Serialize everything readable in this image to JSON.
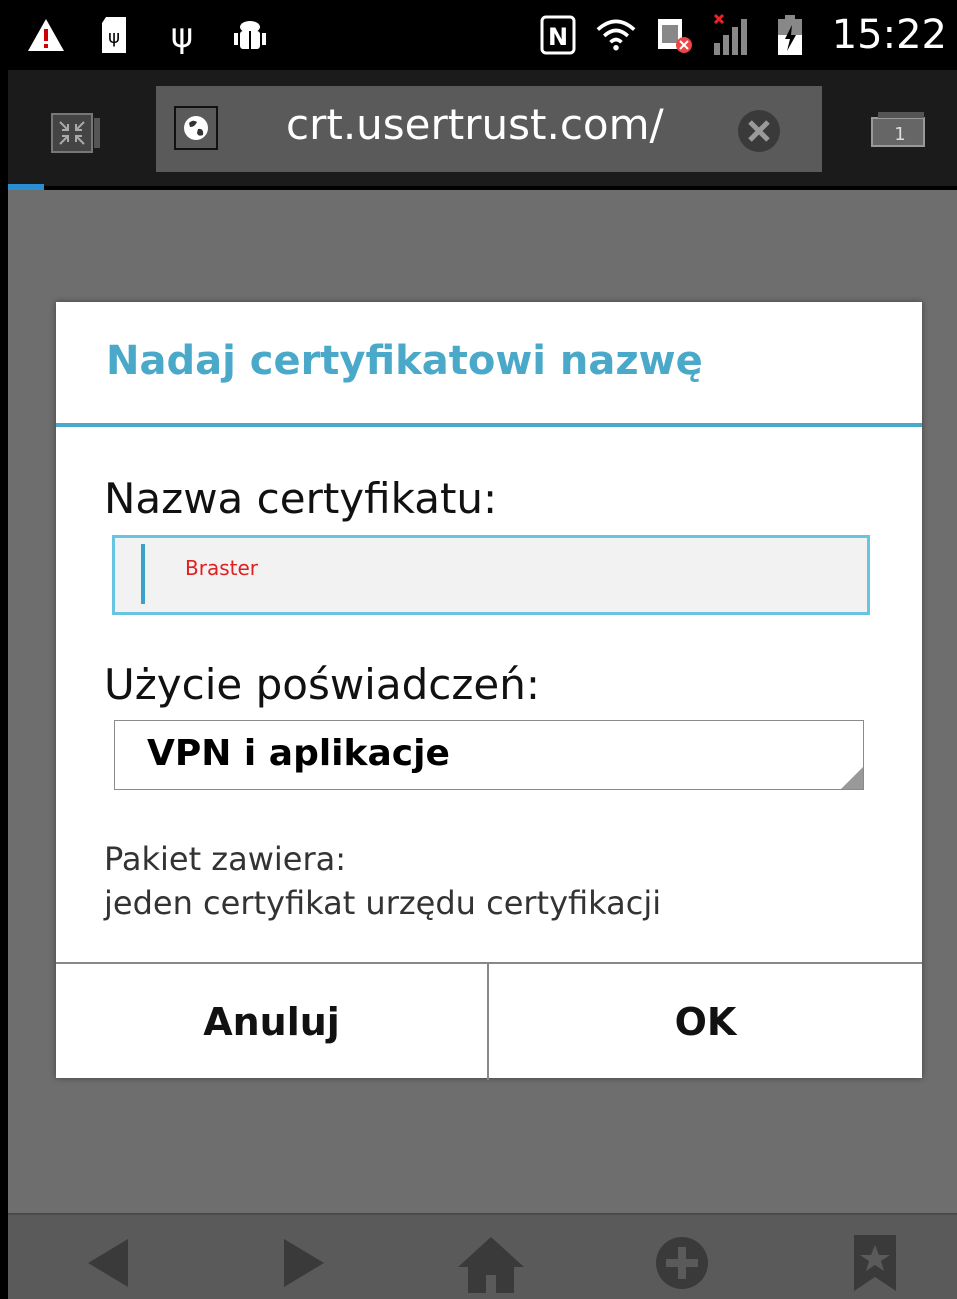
{
  "status_bar": {
    "time": "15:22",
    "left_icons": [
      "warning-icon",
      "sd-card-icon",
      "usb-icon",
      "android-debug-icon"
    ],
    "right_icons": [
      "nfc-icon",
      "wifi-icon",
      "sim-error-icon",
      "signal-no-service-icon",
      "battery-charging-icon"
    ]
  },
  "browser": {
    "url": "crt.usertrust.com/"
  },
  "dialog": {
    "title": "Nadaj certyfikatowi nazwę",
    "name_label": "Nazwa certyfikatu:",
    "name_value": "Braster",
    "usage_label": "Użycie poświadczeń:",
    "usage_value": "VPN i aplikacje",
    "package_label": "Pakiet zawiera:",
    "package_content": "jeden certyfikat urzędu certyfikacji",
    "cancel_label": "Anuluj",
    "ok_label": "OK"
  },
  "bottom_nav": [
    "back-icon",
    "forward-icon",
    "home-icon",
    "add-icon",
    "bookmarks-icon"
  ],
  "colors": {
    "accent": "#4aa8c8",
    "input_text": "#e02020",
    "overlay": "#6e6e6e"
  }
}
